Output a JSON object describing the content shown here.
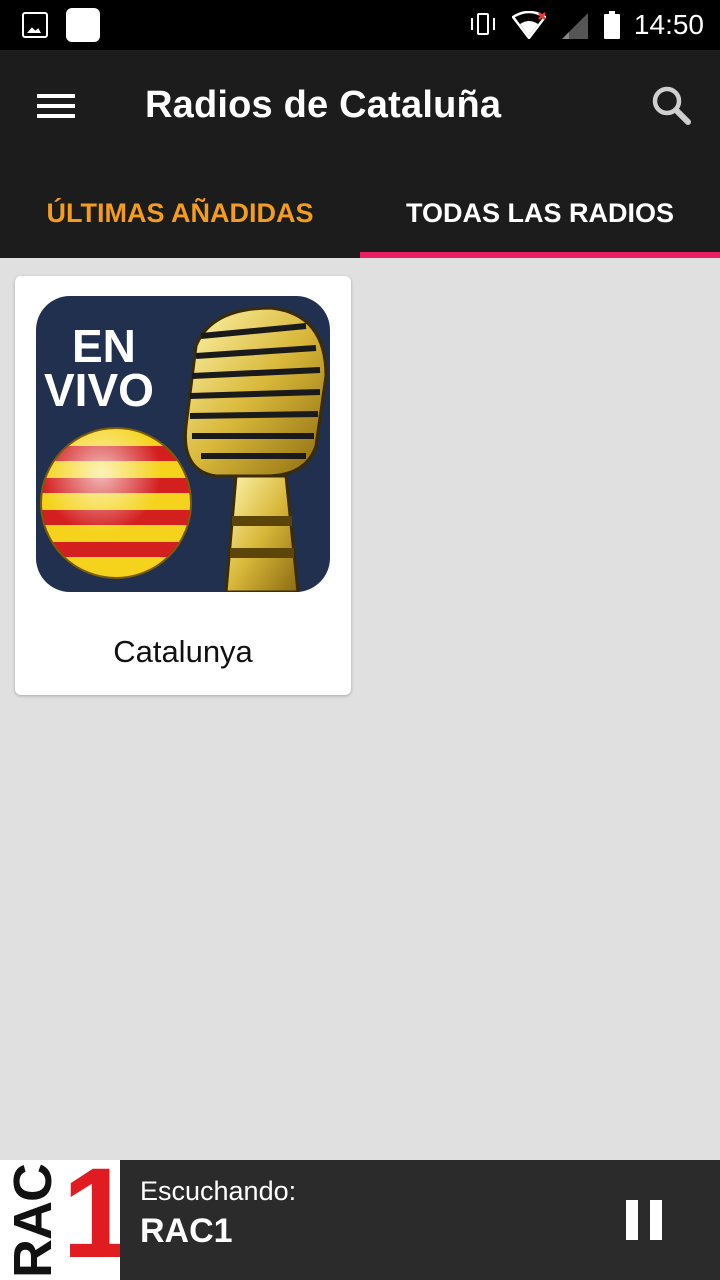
{
  "status_bar": {
    "time": "14:50",
    "icons": [
      "image-icon",
      "white-square-icon",
      "vibrate-icon",
      "wifi-icon",
      "signal-icon",
      "battery-icon"
    ]
  },
  "app_bar": {
    "title": "Radios de Cataluña",
    "menu_icon": "menu-icon",
    "search_icon": "search-icon"
  },
  "tabs": [
    {
      "label": "ÚLTIMAS AÑADIDAS",
      "active": false,
      "color": "#f39c1f"
    },
    {
      "label": "TODAS LAS RADIOS",
      "active": true,
      "color": "#ffffff"
    }
  ],
  "accent_color": "#e91e63",
  "grid": {
    "items": [
      {
        "label": "Catalunya",
        "art_text": "EN VIVO"
      }
    ]
  },
  "player": {
    "logo_text": "RAC",
    "logo_number": "1",
    "status_label": "Escuchando:",
    "station": "RAC1",
    "action_icon": "pause-icon"
  }
}
